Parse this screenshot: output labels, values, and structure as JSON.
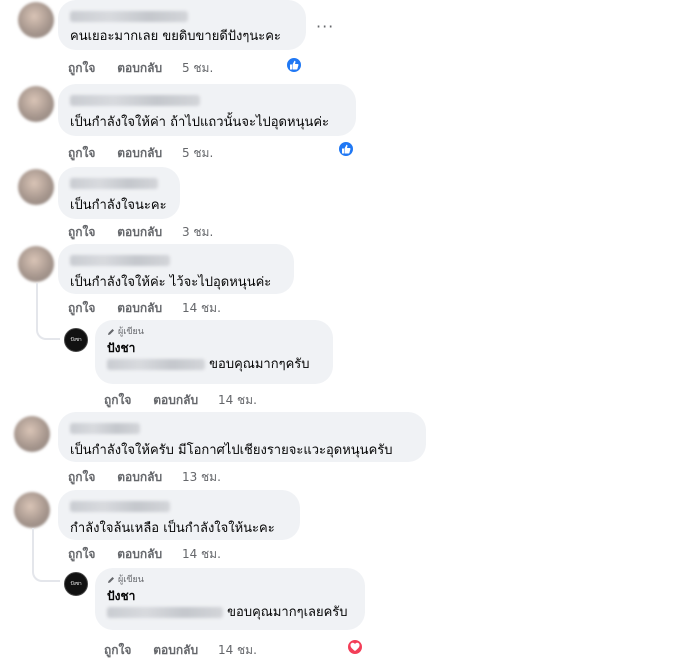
{
  "comments": [
    {
      "text": "คนเยอะมากเลย ขยดิบขายดีปังๆนะคะ",
      "like": "ถูกใจ",
      "reply": "ตอบกลับ",
      "time": "5 ชม.",
      "reaction": "like"
    },
    {
      "text": "เป็นกำลังใจให้ค่า ถ้าไปแถวนั้นจะไปอุดหนุนค่ะ",
      "like": "ถูกใจ",
      "reply": "ตอบกลับ",
      "time": "5 ชม.",
      "reaction": "like"
    },
    {
      "text": "เป็นกำลังใจนะคะ",
      "like": "ถูกใจ",
      "reply": "ตอบกลับ",
      "time": "3 ชม."
    },
    {
      "text": "เป็นกำลังใจให้ค่ะ ไว้จะไปอุดหนุนค่ะ",
      "like": "ถูกใจ",
      "reply": "ตอบกลับ",
      "time": "14 ชม."
    },
    {
      "text": "เป็นกำลังใจให้ครับ มีโอกาศไปเชียงรายจะแวะอุดหนุนครับ",
      "like": "ถูกใจ",
      "reply": "ตอบกลับ",
      "time": "13 ชม."
    },
    {
      "text": "กำลังใจล้นเหลือ เป็นกำลังใจให้นะคะ",
      "like": "ถูกใจ",
      "reply": "ตอบกลับ",
      "time": "14 ชม."
    }
  ],
  "replies": [
    {
      "badge": "ผู้เขียน",
      "author": "ปังชา",
      "text": "ขอบคุณมากๆครับ",
      "like": "ถูกใจ",
      "reply": "ตอบกลับ",
      "time": "14 ชม.",
      "avatar_text": "ปังชา"
    },
    {
      "badge": "ผู้เขียน",
      "author": "ปังชา",
      "text": "ขอบคุณมากๆเลยครับ",
      "like": "ถูกใจ",
      "reply": "ตอบกลับ",
      "time": "14 ชม.",
      "avatar_text": "ปังชา",
      "reaction": "love"
    }
  ],
  "more_label": "···",
  "colors": {
    "bubble": "#f0f2f5",
    "meta": "#65676b",
    "like": "#2078f4",
    "love": "#f33e58"
  }
}
